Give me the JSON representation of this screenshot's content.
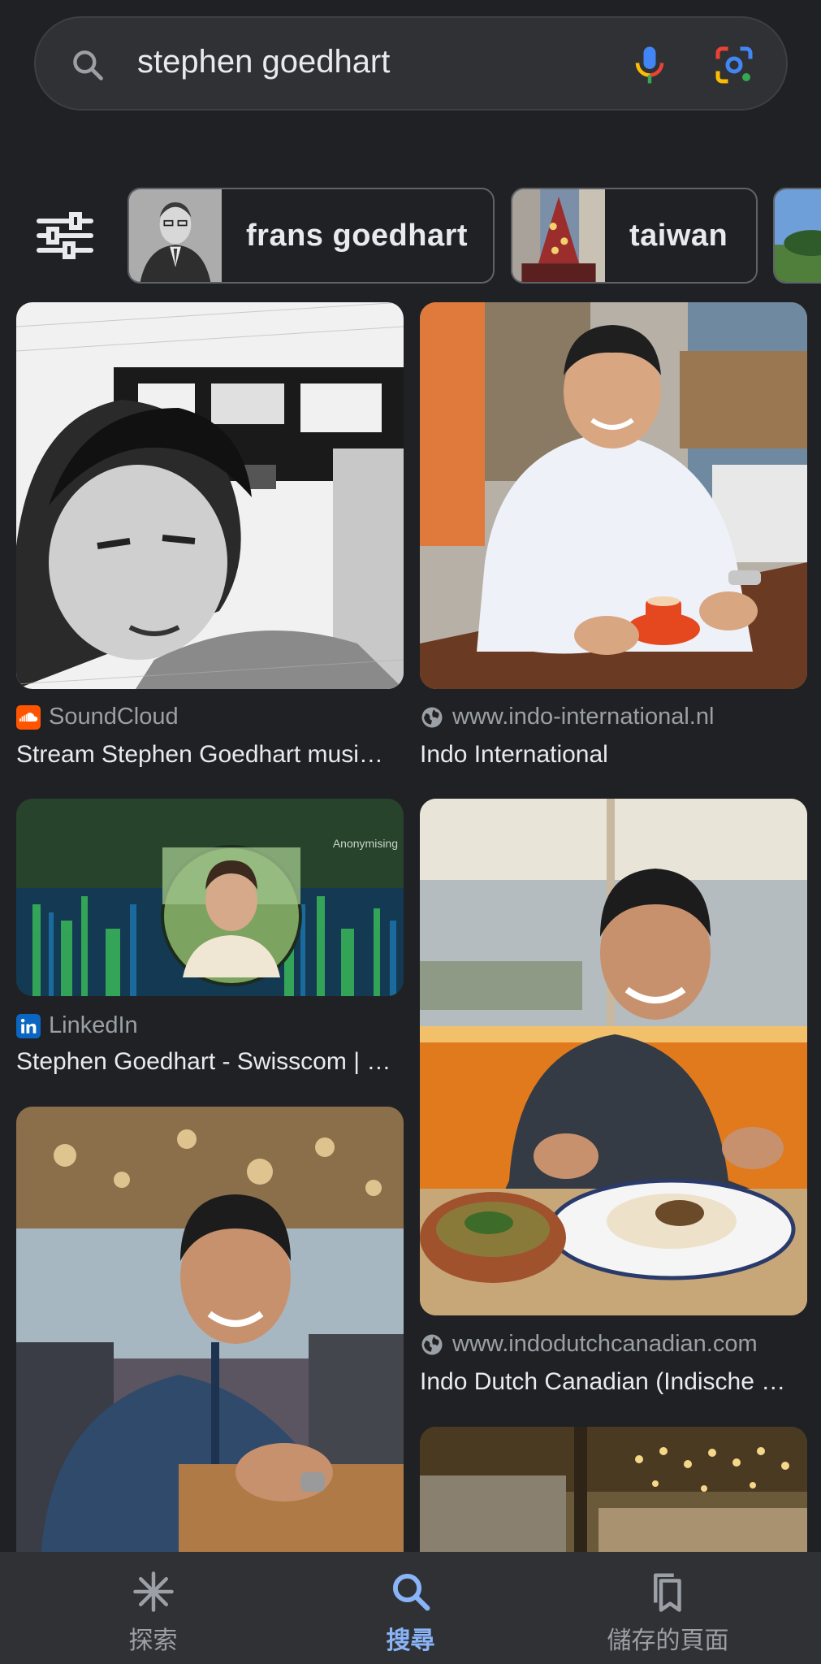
{
  "search": {
    "query": "stephen goedhart"
  },
  "chips": [
    {
      "label": "frans goedhart"
    },
    {
      "label": "taiwan"
    }
  ],
  "results": [
    {
      "source": "SoundCloud",
      "title": "Stream Stephen Goedhart musi…"
    },
    {
      "source": "www.indo-international.nl",
      "title": "Indo International"
    },
    {
      "source": "LinkedIn",
      "title": "Stephen Goedhart - Swisscom | …",
      "overlay_text": "Anonymising"
    },
    {
      "source": "www.indodutchcanadian.com",
      "title": "Indo Dutch Canadian (Indische …"
    }
  ],
  "nav": [
    {
      "label": "探索",
      "icon": "asterisk-icon"
    },
    {
      "label": "搜尋",
      "icon": "search-icon"
    },
    {
      "label": "儲存的頁面",
      "icon": "bookmarks-icon"
    }
  ],
  "colors": {
    "background": "#202124",
    "accent": "#8ab4f8",
    "soundcloud": "#ff5500",
    "linkedin": "#0a66c2"
  }
}
